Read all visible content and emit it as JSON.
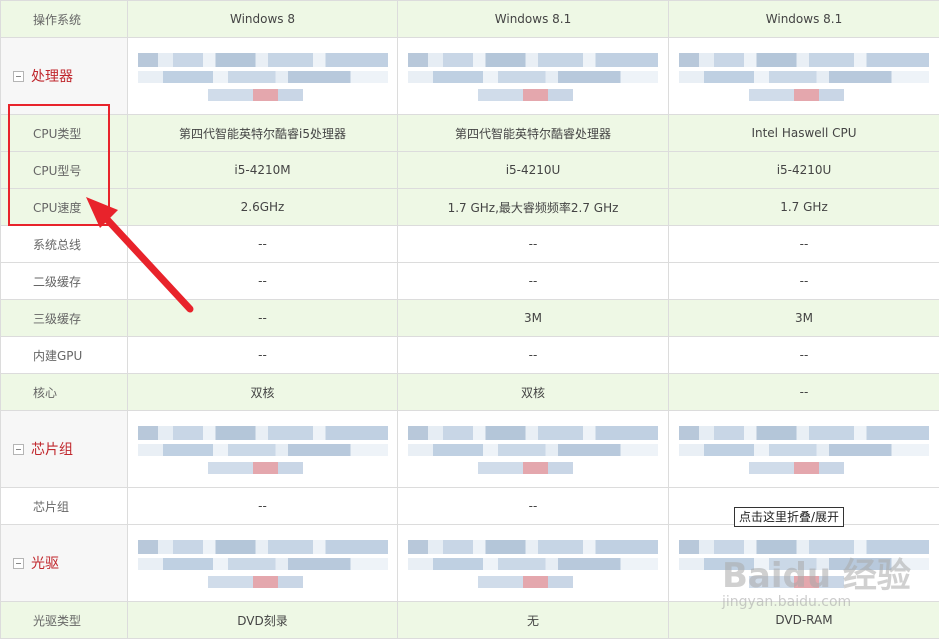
{
  "header": {
    "label": "操作系统",
    "cols": [
      "Windows 8",
      "Windows 8.1",
      "Windows 8.1"
    ]
  },
  "rows": [
    {
      "label": "CPU类型",
      "vals": [
        "第四代智能英特尔酷睿i5处理器",
        "第四代智能英特尔酷睿处理器",
        "Intel Haswell CPU"
      ]
    },
    {
      "label": "CPU型号",
      "vals": [
        "i5-4210M",
        "i5-4210U",
        "i5-4210U"
      ]
    },
    {
      "label": "CPU速度",
      "vals": [
        "2.6GHz",
        "1.7 GHz,最大睿频频率2.7 GHz",
        "1.7 GHz"
      ]
    },
    {
      "label": "系统总线",
      "vals": [
        "--",
        "--",
        "--"
      ]
    },
    {
      "label": "二级缓存",
      "vals": [
        "--",
        "--",
        "--"
      ]
    },
    {
      "label": "三级缓存",
      "vals": [
        "--",
        "3M",
        "3M"
      ]
    },
    {
      "label": "内建GPU",
      "vals": [
        "--",
        "--",
        "--"
      ]
    },
    {
      "label": "核心",
      "vals": [
        "双核",
        "双核",
        "--"
      ]
    },
    {
      "label": "芯片组",
      "vals": [
        "--",
        "--",
        ""
      ]
    },
    {
      "label": "光驱类型",
      "vals": [
        "DVD刻录",
        "无",
        "DVD-RAM"
      ]
    }
  ],
  "sections": {
    "processor": "处理器",
    "chipset": "芯片组",
    "optical": "光驱"
  },
  "tooltip": "点击这里折叠/展开",
  "watermark": {
    "brand": "Baidu 经验",
    "url": "jingyan.baidu.com"
  },
  "colors": {
    "highlight_red": "#e8232b",
    "row_green": "#eef8e5",
    "section_red": "#c0272d"
  }
}
